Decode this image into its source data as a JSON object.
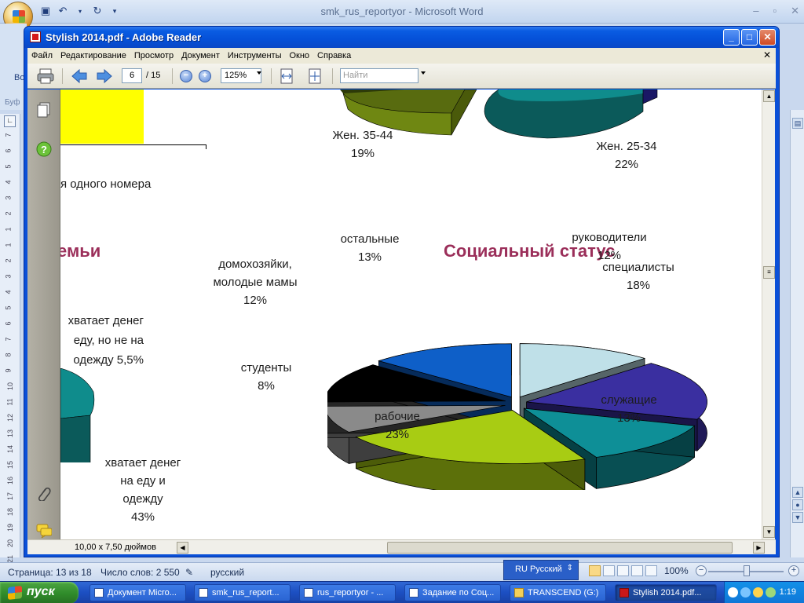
{
  "word": {
    "caption": "smk_rus_reportyor - Microsoft Word",
    "ribbon_label": "Во",
    "clipboard_label": "Буф",
    "ruler_ticks": [
      "7",
      "6",
      "5",
      "4",
      "3",
      "2",
      "1",
      "1",
      "2",
      "3",
      "4",
      "5",
      "6",
      "7",
      "8",
      "9",
      "10",
      "11",
      "12",
      "13",
      "14",
      "15",
      "16",
      "17",
      "18",
      "19",
      "20",
      "21"
    ],
    "status": {
      "page": "Страница: 13 из 18",
      "words": "Число слов: 2 550",
      "language": "русский",
      "zoom": "100%"
    },
    "input_language": "RU Русский"
  },
  "reader": {
    "title": "Stylish 2014.pdf - Adobe Reader",
    "menu": [
      "Файл",
      "Редактирование",
      "Просмотр",
      "Документ",
      "Инструменты",
      "Окно",
      "Справка"
    ],
    "page_current": "6",
    "page_total": "/ 15",
    "zoom": "125%",
    "search_placeholder": "Найти",
    "page_size": "10,00 x 7,50 дюймов"
  },
  "pdf": {
    "top_labels": [
      {
        "text": "Жен. 35-44",
        "pct": "19%"
      },
      {
        "text": "Жен. 25-34",
        "pct": "22%"
      }
    ],
    "partial_text_1": "я одного номера",
    "partial_title": "емьи",
    "partial_lines": [
      "хватает денег",
      "еду, но не на",
      "одежду 5,5%"
    ],
    "bottom_left_lines": [
      "хватает денег",
      "на еду и",
      "одежду",
      "43%"
    ],
    "title": "Социальный статус",
    "chart_data": {
      "type": "pie",
      "title": "Социальный статус",
      "categories": [
        "руководители",
        "специалисты",
        "служащие",
        "рабочие",
        "студенты",
        "домохозяйки, молодые мамы",
        "остальные"
      ],
      "values": [
        12,
        18,
        13,
        23,
        8,
        12,
        13
      ],
      "labels": [
        "12%",
        "18%",
        "13%",
        "23%",
        "8%",
        "12%",
        "13%"
      ],
      "colors": [
        "#bfe0e8",
        "#3a2fa0",
        "#0e8f97",
        "#a8cc13",
        "#8a8a8a",
        "#000000",
        "#0e5fc8"
      ]
    }
  },
  "taskbar": {
    "start": "пуск",
    "items": [
      "Документ Micro...",
      "smk_rus_report...",
      "rus_reportyor - ...",
      "Задание по Соц...",
      "TRANSCEND (G:)",
      "Stylish 2014.pdf..."
    ],
    "clock": "1:19"
  },
  "icons": {
    "save": "save-icon",
    "undo": "undo-icon",
    "redo": "redo-icon",
    "print": "print-icon",
    "prev": "arrow-left-icon",
    "next": "arrow-right-icon",
    "zoom_out": "zoom-out-icon",
    "zoom_in": "zoom-in-icon",
    "fit_width": "fit-width-icon",
    "fit_page": "fit-page-icon",
    "pages": "pages-icon",
    "help": "help-icon",
    "attach": "paperclip-icon",
    "comments": "comments-icon"
  }
}
